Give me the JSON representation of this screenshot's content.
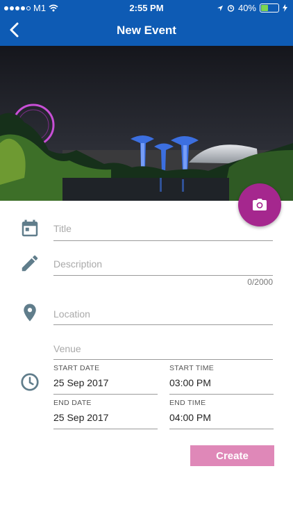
{
  "status_bar": {
    "carrier": "M1",
    "time": "2:55 PM",
    "battery": "40%"
  },
  "nav": {
    "title": "New Event",
    "back_icon": "chevron-left-icon"
  },
  "hero_image": "night-garden-skyline-photo",
  "fab_icon": "camera-icon",
  "form": {
    "title": {
      "placeholder": "Title",
      "icon": "calendar-icon"
    },
    "description": {
      "placeholder": "Description",
      "icon": "pencil-icon",
      "counter": "0/2000"
    },
    "location": {
      "placeholder": "Location",
      "icon": "map-pin-icon"
    },
    "venue": {
      "placeholder": "Venue"
    },
    "datetime_icon": "clock-icon",
    "start_date": {
      "label": "START DATE",
      "value": "25 Sep 2017"
    },
    "start_time": {
      "label": "START TIME",
      "value": "03:00 PM"
    },
    "end_date": {
      "label": "END DATE",
      "value": "25 Sep 2017"
    },
    "end_time": {
      "label": "END TIME",
      "value": "04:00 PM"
    }
  },
  "actions": {
    "create_label": "Create"
  },
  "colors": {
    "navbar": "#0e5bb4",
    "fab": "#a5278e",
    "create_button": "#df88b8",
    "icon": "#607d8b"
  }
}
